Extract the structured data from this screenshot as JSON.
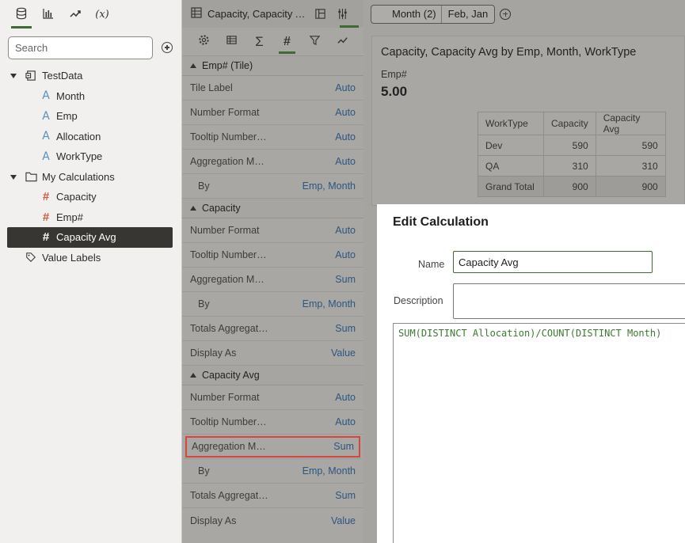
{
  "left": {
    "tabs": [
      {
        "icon": "database-icon"
      },
      {
        "icon": "bar-chart-icon"
      },
      {
        "icon": "trend-line-icon"
      },
      {
        "icon": "variable-icon",
        "label": "(x)"
      }
    ],
    "search_placeholder": "Search",
    "tree": [
      {
        "label": "TestData",
        "icon": "dataset-icon",
        "level": 0,
        "expanded": true
      },
      {
        "label": "Month",
        "icon": "attribute-icon",
        "level": 1
      },
      {
        "label": "Emp",
        "icon": "attribute-icon",
        "level": 1
      },
      {
        "label": "Allocation",
        "icon": "attribute-icon",
        "level": 1
      },
      {
        "label": "WorkType",
        "icon": "attribute-icon",
        "level": 1
      },
      {
        "label": "My Calculations",
        "icon": "folder-icon",
        "level": 0,
        "expanded": true
      },
      {
        "label": "Capacity",
        "icon": "measure-icon",
        "level": 1
      },
      {
        "label": "Emp#",
        "icon": "measure-icon",
        "level": 1
      },
      {
        "label": "Capacity Avg",
        "icon": "measure-icon",
        "level": 1,
        "selected": true
      },
      {
        "label": "Value Labels",
        "icon": "tag-icon",
        "level": 0
      }
    ]
  },
  "middle": {
    "title": "Capacity, Capacity Avg by Emp, Month, WorkType",
    "sections": [
      {
        "header": "Emp# (Tile)",
        "props": [
          {
            "k": "Tile Label",
            "v": "Auto"
          },
          {
            "k": "Number Format",
            "v": "Auto"
          },
          {
            "k": "Tooltip Number…",
            "v": "Auto"
          },
          {
            "k": "Aggregation M…",
            "v": "Auto"
          },
          {
            "k": "By",
            "v": "Emp, Month",
            "indent": true
          }
        ]
      },
      {
        "header": "Capacity",
        "props": [
          {
            "k": "Number Format",
            "v": "Auto"
          },
          {
            "k": "Tooltip Number…",
            "v": "Auto"
          },
          {
            "k": "Aggregation M…",
            "v": "Sum"
          },
          {
            "k": "By",
            "v": "Emp, Month",
            "indent": true
          },
          {
            "k": "Totals Aggregat…",
            "v": "Sum"
          },
          {
            "k": "Display As",
            "v": "Value"
          }
        ]
      },
      {
        "header": "Capacity Avg",
        "props": [
          {
            "k": "Number Format",
            "v": "Auto"
          },
          {
            "k": "Tooltip Number…",
            "v": "Auto"
          },
          {
            "k": "Aggregation M…",
            "v": "Sum",
            "highlight": true
          },
          {
            "k": "By",
            "v": "Emp, Month",
            "indent": true
          },
          {
            "k": "Totals Aggregat…",
            "v": "Sum"
          },
          {
            "k": "Display As",
            "v": "Value"
          }
        ]
      }
    ]
  },
  "right": {
    "filter": {
      "key": "Month (2)",
      "value": "Feb, Jan"
    },
    "viz_title": "Capacity, Capacity Avg by Emp, Month, WorkType",
    "tile_label": "Emp#",
    "tile_value": "5.00",
    "table": {
      "headers": [
        "WorkType",
        "Capacity",
        "Capacity Avg"
      ],
      "rows": [
        [
          "Dev",
          "590",
          "590"
        ],
        [
          "QA",
          "310",
          "310"
        ]
      ],
      "total": [
        "Grand Total",
        "900",
        "900"
      ]
    }
  },
  "dialog": {
    "title": "Edit Calculation",
    "name_label": "Name",
    "name_value": "Capacity Avg",
    "description_label": "Description",
    "expression": "SUM(DISTINCT Allocation)/COUNT(DISTINCT Month)"
  }
}
